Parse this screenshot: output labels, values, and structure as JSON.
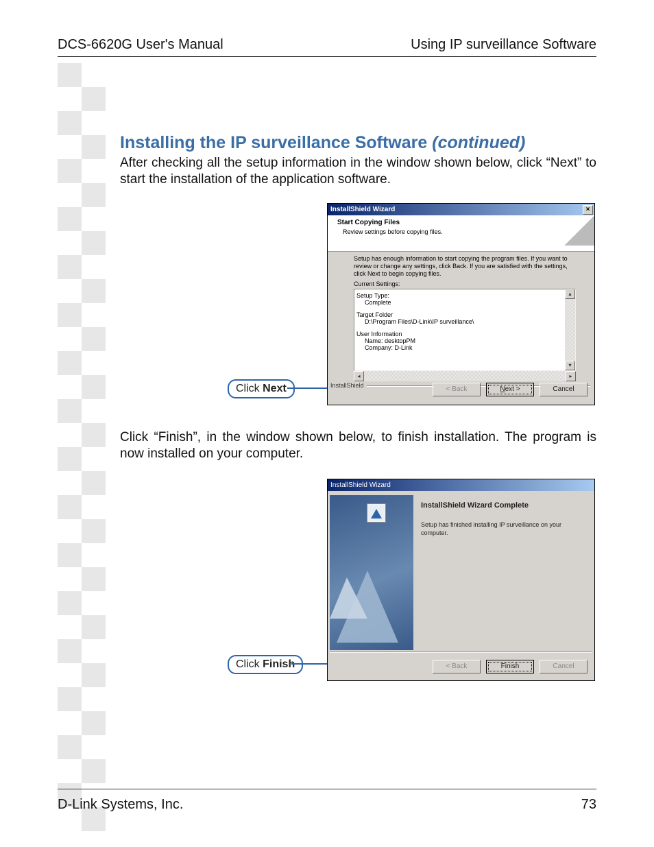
{
  "header": {
    "left": "DCS-6620G User's Manual",
    "right": "Using IP surveillance Software"
  },
  "footer": {
    "left": "D-Link Systems, Inc.",
    "page": "73"
  },
  "section": {
    "title_main": "Installing the IP surveillance Software ",
    "title_cont": "(continued)"
  },
  "para1": "After checking all the setup information in the window shown below, click “Next” to start the installation of the application software.",
  "para2": "Click “Finish”, in the window shown below, to finish installation. The program is now installed on your computer.",
  "callouts": {
    "next_pre": "Click ",
    "next_bold": "Next",
    "finish_pre": "Click ",
    "finish_bold": "Finish"
  },
  "wiz1": {
    "title": "InstallShield Wizard",
    "close_x": "×",
    "h1": "Start Copying Files",
    "h2": "Review settings before copying files.",
    "instr": "Setup has enough information to start copying the program files.  If you want to review or change any settings, click Back.  If you are satisfied with the settings, click Next to begin copying files.",
    "current_settings_label": "Current Settings:",
    "settings": {
      "setup_type_label": "Setup Type:",
      "setup_type_value": "Complete",
      "target_folder_label": "Target Folder",
      "target_folder_value": "D:\\Program Files\\D-Link\\IP surveillance\\",
      "user_info_label": "User Information",
      "user_info_name": "Name: desktopPM",
      "user_info_company": "Company: D-Link"
    },
    "group_label": "InstallShield",
    "scroll_up": "▴",
    "scroll_down": "▾",
    "scroll_left": "◂",
    "scroll_right": "▸",
    "buttons": {
      "back": "< Back",
      "next": "Next >",
      "cancel": "Cancel"
    }
  },
  "wiz2": {
    "title": "InstallShield Wizard",
    "heading": "InstallShield Wizard Complete",
    "text": "Setup has finished installing IP surveillance on your computer.",
    "buttons": {
      "back": "< Back",
      "finish": "Finish",
      "cancel": "Cancel"
    }
  }
}
